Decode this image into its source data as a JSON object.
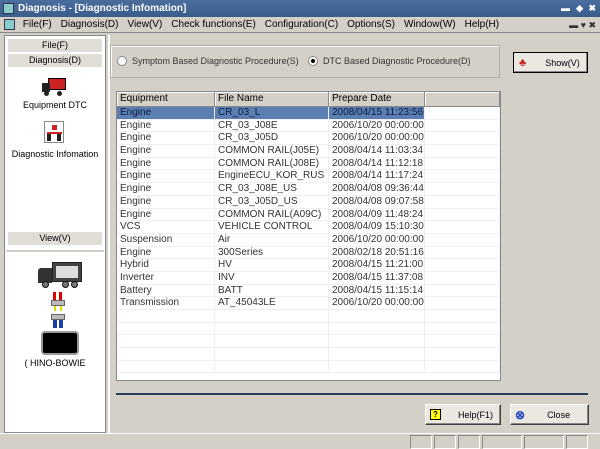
{
  "window": {
    "title": "Diagnosis - [Diagnostic Infomation]"
  },
  "menu": [
    "File(F)",
    "Diagnosis(D)",
    "View(V)",
    "Check functions(E)",
    "Configuration(C)",
    "Options(S)",
    "Window(W)",
    "Help(H)"
  ],
  "left": {
    "file": "File(F)",
    "diagnosis": "Diagnosis(D)",
    "equipment_dtc": "Equipment DTC",
    "diag_info": "Diagnostic Infomation",
    "view": "View(V)",
    "device": "( HINO-BOWIE"
  },
  "procedure": {
    "symptom": "Symptom Based Diagnostic Procedure(S)",
    "dtc": "DTC Based Diagnostic Procedure(D)",
    "selected": "dtc"
  },
  "show_label": "Show(V)",
  "table": {
    "headers": [
      "Equipment",
      "File Name",
      "Prepare Date"
    ],
    "rows": [
      [
        "Engine",
        "CR_03_L",
        "2008/04/15 11:23:56"
      ],
      [
        "Engine",
        "CR_03_J08E",
        "2006/10/20 00:00:00"
      ],
      [
        "Engine",
        "CR_03_J05D",
        "2006/10/20 00:00:00"
      ],
      [
        "Engine",
        "COMMON RAIL(J05E)",
        "2008/04/14 11:03:34"
      ],
      [
        "Engine",
        "COMMON RAIL(J08E)",
        "2008/04/14 11:12:18"
      ],
      [
        "Engine",
        "EngineECU_KOR_RUS",
        "2008/04/14 11:17:24"
      ],
      [
        "Engine",
        "CR_03_J08E_US",
        "2008/04/08 09:36:44"
      ],
      [
        "Engine",
        "CR_03_J05D_US",
        "2008/04/08 09:07:58"
      ],
      [
        "Engine",
        "COMMON RAIL(A09C)",
        "2008/04/09 11:48:24"
      ],
      [
        "VCS",
        "VEHICLE CONTROL",
        "2008/04/09 15:10:30"
      ],
      [
        "Suspension",
        "Air",
        "2006/10/20 00:00:00"
      ],
      [
        "Engine",
        "300Series",
        "2008/02/18 20:51:16"
      ],
      [
        "Hybrid",
        "HV",
        "2008/04/15 11:21:00"
      ],
      [
        "Inverter",
        "INV",
        "2008/04/15 11:37:08"
      ],
      [
        "Battery",
        "BATT",
        "2008/04/15 11:15:14"
      ],
      [
        "Transmission",
        "AT_45043LE",
        "2006/10/20 00:00:00"
      ]
    ],
    "selected_row": 0
  },
  "buttons": {
    "help": "Help(F1)",
    "close": "Close"
  }
}
